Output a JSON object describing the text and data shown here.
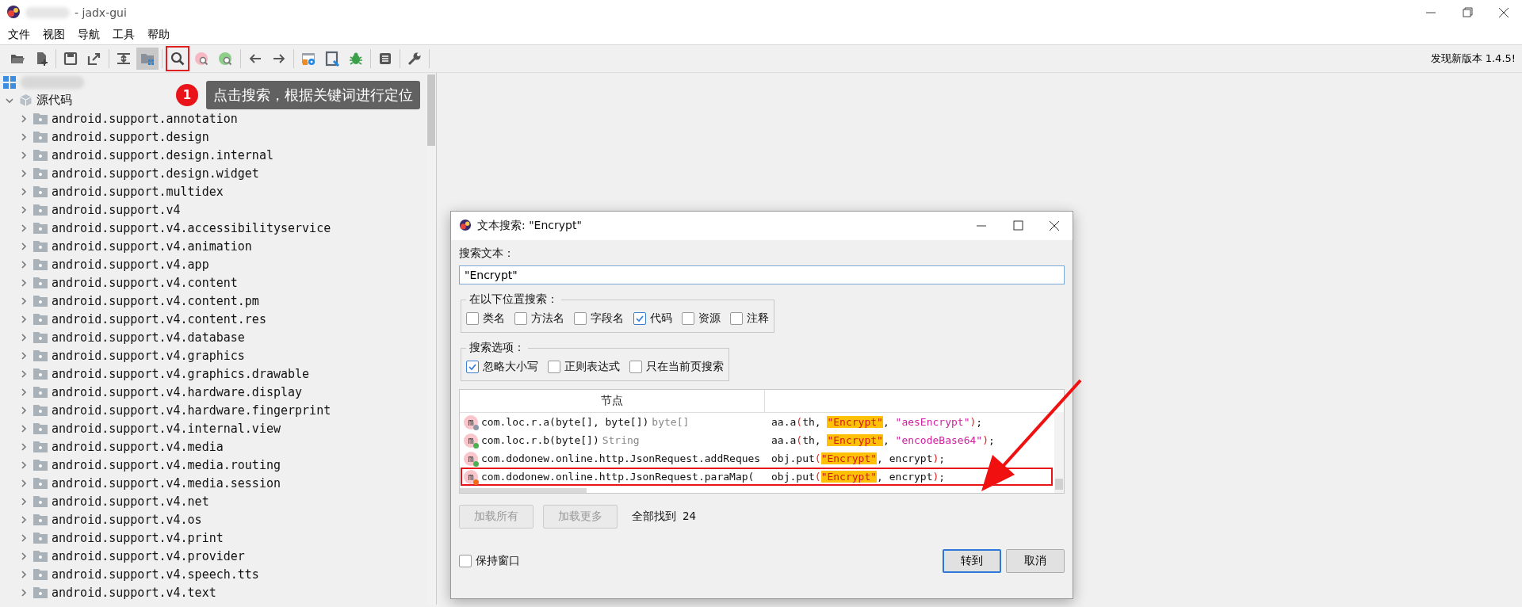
{
  "window": {
    "title": "- jadx-gui"
  },
  "menu": [
    "文件",
    "视图",
    "导航",
    "工具",
    "帮助"
  ],
  "toolbar": [
    [
      {
        "kind": "open",
        "pressed": false,
        "marked": false
      },
      {
        "kind": "add",
        "pressed": false,
        "marked": false
      }
    ],
    [
      {
        "kind": "save",
        "pressed": false,
        "marked": false
      },
      {
        "kind": "export",
        "pressed": false,
        "marked": false
      }
    ],
    [
      {
        "kind": "sync",
        "pressed": false,
        "marked": false
      },
      {
        "kind": "flatten",
        "pressed": true,
        "marked": false
      }
    ],
    [
      {
        "kind": "search",
        "pressed": false,
        "marked": true
      },
      {
        "kind": "class-search",
        "pressed": false,
        "marked": false
      },
      {
        "kind": "usage-search",
        "pressed": false,
        "marked": false
      }
    ],
    [
      {
        "kind": "back",
        "pressed": false,
        "marked": false
      },
      {
        "kind": "forward",
        "pressed": false,
        "marked": false
      }
    ],
    [
      {
        "kind": "deobf",
        "pressed": false,
        "marked": false
      },
      {
        "kind": "quark",
        "pressed": false,
        "marked": false
      },
      {
        "kind": "debug",
        "pressed": false,
        "marked": false
      }
    ],
    [
      {
        "kind": "log",
        "pressed": false,
        "marked": false
      }
    ],
    [
      {
        "kind": "prefs",
        "pressed": false,
        "marked": false
      }
    ]
  ],
  "update_notice": "发现新版本 1.4.5!",
  "callout": {
    "badge": "1",
    "text": "点击搜索，根据关键词进行定位"
  },
  "tree": {
    "expanded": true,
    "children": [
      {
        "label": "源代码",
        "expanded": true,
        "children": [
          {
            "label": "android.support.annotation",
            "expanded": false
          },
          {
            "label": "android.support.design",
            "expanded": false
          },
          {
            "label": "android.support.design.internal",
            "expanded": false
          },
          {
            "label": "android.support.design.widget",
            "expanded": false
          },
          {
            "label": "android.support.multidex",
            "expanded": false
          },
          {
            "label": "android.support.v4",
            "expanded": false
          },
          {
            "label": "android.support.v4.accessibilityservice",
            "expanded": false
          },
          {
            "label": "android.support.v4.animation",
            "expanded": false
          },
          {
            "label": "android.support.v4.app",
            "expanded": false
          },
          {
            "label": "android.support.v4.content",
            "expanded": false
          },
          {
            "label": "android.support.v4.content.pm",
            "expanded": false
          },
          {
            "label": "android.support.v4.content.res",
            "expanded": false
          },
          {
            "label": "android.support.v4.database",
            "expanded": false
          },
          {
            "label": "android.support.v4.graphics",
            "expanded": false
          },
          {
            "label": "android.support.v4.graphics.drawable",
            "expanded": false
          },
          {
            "label": "android.support.v4.hardware.display",
            "expanded": false
          },
          {
            "label": "android.support.v4.hardware.fingerprint",
            "expanded": false
          },
          {
            "label": "android.support.v4.internal.view",
            "expanded": false
          },
          {
            "label": "android.support.v4.media",
            "expanded": false
          },
          {
            "label": "android.support.v4.media.routing",
            "expanded": false
          },
          {
            "label": "android.support.v4.media.session",
            "expanded": false
          },
          {
            "label": "android.support.v4.net",
            "expanded": false
          },
          {
            "label": "android.support.v4.os",
            "expanded": false
          },
          {
            "label": "android.support.v4.print",
            "expanded": false
          },
          {
            "label": "android.support.v4.provider",
            "expanded": false
          },
          {
            "label": "android.support.v4.speech.tts",
            "expanded": false
          },
          {
            "label": "android.support.v4.text",
            "expanded": false
          }
        ]
      }
    ]
  },
  "dialog": {
    "title": "文本搜索: \"Encrypt\"",
    "search_label": "搜索文本：",
    "search_value": "\"Encrypt\"",
    "scope_title": "在以下位置搜索：",
    "scope": [
      {
        "label": "类名",
        "checked": false
      },
      {
        "label": "方法名",
        "checked": false
      },
      {
        "label": "字段名",
        "checked": false
      },
      {
        "label": "代码",
        "checked": true
      },
      {
        "label": "资源",
        "checked": false
      },
      {
        "label": "注释",
        "checked": false
      }
    ],
    "options_title": "搜索选项：",
    "options": [
      {
        "label": "忽略大小写",
        "checked": true
      },
      {
        "label": "正则表达式",
        "checked": false
      },
      {
        "label": "只在当前页搜索",
        "checked": false
      }
    ],
    "columns": [
      "节点"
    ],
    "results": [
      {
        "icon": "m",
        "color": "#8d99a6",
        "node": "com.loc.r.a(byte[], byte[])",
        "type": "byte[]",
        "highlighted": false,
        "code": [
          {
            "kind": "plain",
            "text": "aa.a"
          },
          {
            "kind": "paren",
            "text": "("
          },
          {
            "kind": "plain",
            "text": "th, "
          },
          {
            "kind": "match",
            "text": "\"Encrypt\""
          },
          {
            "kind": "plain",
            "text": ", "
          },
          {
            "kind": "string",
            "text": "\"aesEncrypt\""
          },
          {
            "kind": "paren",
            "text": ")"
          },
          {
            "kind": "plain",
            "text": ";"
          }
        ]
      },
      {
        "icon": "m",
        "color": "#4caf50",
        "node": "com.loc.r.b(byte[])",
        "type": "String",
        "highlighted": false,
        "code": [
          {
            "kind": "plain",
            "text": "aa.a"
          },
          {
            "kind": "paren",
            "text": "("
          },
          {
            "kind": "plain",
            "text": "th, "
          },
          {
            "kind": "match",
            "text": "\"Encrypt\""
          },
          {
            "kind": "plain",
            "text": ", "
          },
          {
            "kind": "string",
            "text": "\"encodeBase64\""
          },
          {
            "kind": "paren",
            "text": ")"
          },
          {
            "kind": "plain",
            "text": ";"
          }
        ]
      },
      {
        "icon": "m",
        "color": "#4caf50",
        "node": "com.dodonew.online.http.JsonRequest.addReques",
        "highlighted": false,
        "code": [
          {
            "kind": "plain",
            "text": "obj.put"
          },
          {
            "kind": "paren",
            "text": "("
          },
          {
            "kind": "match",
            "text": "\"Encrypt\""
          },
          {
            "kind": "plain",
            "text": ", encrypt"
          },
          {
            "kind": "paren",
            "text": ")"
          },
          {
            "kind": "plain",
            "text": ";"
          }
        ]
      },
      {
        "icon": "m",
        "color": "#f26b1d",
        "node": "com.dodonew.online.http.JsonRequest.paraMap(",
        "highlighted": true,
        "code": [
          {
            "kind": "plain",
            "text": "obj.put"
          },
          {
            "kind": "paren",
            "text": "("
          },
          {
            "kind": "match",
            "text": "\"Encrypt\""
          },
          {
            "kind": "plain",
            "text": ", encrypt"
          },
          {
            "kind": "paren",
            "text": ")"
          },
          {
            "kind": "plain",
            "text": ";"
          }
        ]
      }
    ],
    "load_all": {
      "label": "加载所有",
      "disabled": true
    },
    "load_more": {
      "label": "加载更多",
      "disabled": true
    },
    "found_label": "全部找到",
    "found_count": "24",
    "keep_window": {
      "label": "保持窗口",
      "checked": false
    },
    "goto": "转到",
    "cancel": "取消"
  }
}
